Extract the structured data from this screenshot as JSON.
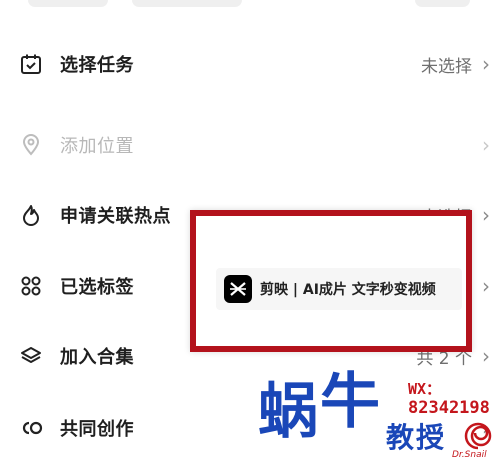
{
  "rows": [
    {
      "icon": "calendar-check-icon",
      "label": "选择任务",
      "value": "未选择",
      "chevron": "›"
    },
    {
      "icon": "location-pin-icon",
      "label": "添加位置",
      "value": "",
      "chevron": "›"
    },
    {
      "icon": "flame-icon",
      "label": "申请关联热点",
      "value": "未选择",
      "chevron": "›"
    },
    {
      "icon": "tag-grid-icon",
      "label": "已选标签",
      "value": "",
      "chevron": "›"
    },
    {
      "icon": "layers-icon",
      "label": "加入合集",
      "value": "共 2 个",
      "chevron": "›"
    },
    {
      "icon": "co-create-icon",
      "label": "共同创作",
      "value": "",
      "chevron": "›"
    }
  ],
  "popup": {
    "app_text": "剪映 | AI成片 文字秒变视频",
    "border_color": "#b3121c"
  },
  "watermark": {
    "chars": "蜗牛教授",
    "wx_label": "WX：",
    "wx_number": "82342198",
    "tag": "Dr.Snail",
    "color": "#1a47b8"
  }
}
